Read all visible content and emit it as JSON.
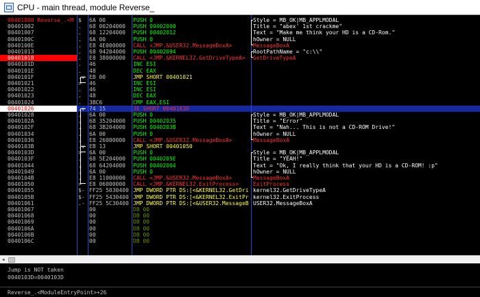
{
  "window": {
    "title": "CPU - main thread, module Reverse_"
  },
  "disasm": {
    "rows": [
      {
        "addr": "00401000 Reverse_.<M",
        "mark": "$",
        "hex": "6A 00",
        "ins": "PUSH 0",
        "cmt": "Style = MB_OK|MB_APPLMODAL",
        "ins_color": "green",
        "cmt_color": "white",
        "addr_entry": true
      },
      {
        "addr": "00401002",
        "mark": ".",
        "hex": "68 00204000",
        "ins": "PUSH 00402000",
        "cmt": "Title = \"abex' 1st crackme\"",
        "ins_color": "green",
        "cmt_color": "white"
      },
      {
        "addr": "00401007",
        "mark": ".",
        "hex": "68 12204000",
        "ins": "PUSH 00402012",
        "cmt": "Text = \"Make me think your HD is a CD-Rom.\"",
        "ins_color": "green",
        "cmt_color": "white"
      },
      {
        "addr": "0040100C",
        "mark": ".",
        "hex": "6A 00",
        "ins": "PUSH 0",
        "cmt": "hOwner = NULL",
        "ins_color": "green",
        "cmt_color": "white"
      },
      {
        "addr": "0040100E",
        "mark": ".",
        "hex": "E8 4E000000",
        "ins": "CALL <JMP.&USER32.MessageBoxA>",
        "cmt": "MessageBoxA",
        "ins_color": "red",
        "cmt_color": "red"
      },
      {
        "addr": "00401013",
        "mark": ".",
        "hex": "68 94204000",
        "ins": "PUSH 00402094",
        "cmt": "RootPathName = \"c:\\\\\"",
        "ins_color": "green",
        "cmt_color": "white"
      },
      {
        "addr": "00401018",
        "mark": ".",
        "hex": "E8 38000000",
        "ins": "CALL <JMP.&KERNEL32.GetDriveTypeA>",
        "cmt": "GetDriveTypeA",
        "ins_color": "red",
        "cmt_color": "red",
        "bp": true
      },
      {
        "addr": "0040101D",
        "mark": ".",
        "hex": "46",
        "ins": "INC ESI",
        "cmt": "",
        "ins_color": "green"
      },
      {
        "addr": "0040101E",
        "mark": ".",
        "hex": "48",
        "ins": "DEC EAX",
        "cmt": "",
        "ins_color": "green"
      },
      {
        "addr": "0040101F",
        "mark": ".v",
        "hex": "EB 00",
        "ins": "JMP SHORT 00401021",
        "cmt": "",
        "ins_color": "yellow"
      },
      {
        "addr": "00401021",
        "mark": ">",
        "hex": "46",
        "ins": "INC ESI",
        "cmt": "",
        "ins_color": "green"
      },
      {
        "addr": "00401022",
        "mark": ".",
        "hex": "46",
        "ins": "INC ESI",
        "cmt": "",
        "ins_color": "green"
      },
      {
        "addr": "00401023",
        "mark": ".",
        "hex": "48",
        "ins": "DEC EAX",
        "cmt": "",
        "ins_color": "green"
      },
      {
        "addr": "00401024",
        "mark": ".",
        "hex": "3BC6",
        "ins": "CMP EAX,ESI",
        "cmt": "",
        "ins_color": "green"
      },
      {
        "addr": "00401026",
        "mark": ".v",
        "hex": "74 15",
        "ins": "JE SHORT 0040103D",
        "cmt": "",
        "ins_color": "red",
        "cur": true
      },
      {
        "addr": "00401028",
        "mark": ".",
        "hex": "6A 00",
        "ins": "PUSH 0",
        "cmt": "Style = MB_OK|MB_APPLMODAL",
        "ins_color": "green",
        "cmt_color": "white"
      },
      {
        "addr": "0040102A",
        "mark": ".",
        "hex": "68 35204000",
        "ins": "PUSH 00402035",
        "cmt": "Title = \"Error\"",
        "ins_color": "green",
        "cmt_color": "white"
      },
      {
        "addr": "0040102F",
        "mark": ".",
        "hex": "68 3B204000",
        "ins": "PUSH 0040203B",
        "cmt": "Text = \"Nah... This is not a CD-ROM Drive!\"",
        "ins_color": "green",
        "cmt_color": "white"
      },
      {
        "addr": "00401034",
        "mark": ".",
        "hex": "6A 00",
        "ins": "PUSH 0",
        "cmt": "hOwner = NULL",
        "ins_color": "green",
        "cmt_color": "white"
      },
      {
        "addr": "00401036",
        "mark": ".",
        "hex": "E8 26000000",
        "ins": "CALL <JMP.&USER32.MessageBoxA>",
        "cmt": "MessageBoxA",
        "ins_color": "red",
        "cmt_color": "red"
      },
      {
        "addr": "0040103B",
        "mark": ".v",
        "hex": "EB 13",
        "ins": "JMP SHORT 00401050",
        "cmt": "",
        "ins_color": "yellow"
      },
      {
        "addr": "0040103D",
        "mark": ">",
        "hex": "6A 00",
        "ins": "PUSH 0",
        "cmt": "Style = MB_OK|MB_APPLMODAL",
        "ins_color": "green",
        "cmt_color": "white"
      },
      {
        "addr": "0040103F",
        "mark": ".",
        "hex": "68 5E204000",
        "ins": "PUSH 0040205E",
        "cmt": "Title = \"YEAH!\"",
        "ins_color": "green",
        "cmt_color": "white"
      },
      {
        "addr": "00401044",
        "mark": ".",
        "hex": "68 64204000",
        "ins": "PUSH 00402064",
        "cmt": "Text = \"Ok, I really think that your HD is a CD-ROM! :p\"",
        "ins_color": "green",
        "cmt_color": "white"
      },
      {
        "addr": "00401049",
        "mark": ".",
        "hex": "6A 00",
        "ins": "PUSH 0",
        "cmt": "hOwner = NULL",
        "ins_color": "green",
        "cmt_color": "white"
      },
      {
        "addr": "0040104B",
        "mark": ".",
        "hex": "E8 11000000",
        "ins": "CALL <JMP.&USER32.MessageBoxA>",
        "cmt": "MessageBoxA",
        "ins_color": "red",
        "cmt_color": "red"
      },
      {
        "addr": "00401050",
        "mark": ">",
        "hex": "E8 06000000",
        "ins": "CALL <JMP.&KERNEL32.ExitProcess>",
        "cmt": "ExitProcess",
        "ins_color": "red",
        "cmt_color": "red"
      },
      {
        "addr": "00401055",
        "mark": "$-",
        "hex": "FF25 5030400",
        "ins": "JMP DWORD PTR DS:[<&KERNEL32.GetDri",
        "cmt": "kernel32.GetDriveTypeA",
        "ins_color": "yellow",
        "cmt_color": "white"
      },
      {
        "addr": "0040105B",
        "mark": "$-",
        "hex": "FF25 5430400",
        "ins": "JMP DWORD PTR DS:[<&KERNEL32.ExitPr",
        "cmt": "kernel32.ExitProcess",
        "ins_color": "yellow",
        "cmt_color": "white"
      },
      {
        "addr": "00401061",
        "mark": ".-",
        "hex": "FF25 5C30400",
        "ins": "JMP DWORD PTR DS:[<&USER32.MessageB",
        "cmt": "USER32.MessageBoxA",
        "ins_color": "yellow",
        "cmt_color": "white"
      },
      {
        "addr": "00401067",
        "mark": "",
        "hex": "00",
        "ins": "DB 00",
        "cmt": "",
        "ins_color": "olive"
      },
      {
        "addr": "00401068",
        "mark": "",
        "hex": "00",
        "ins": "DB 00",
        "cmt": "",
        "ins_color": "olive"
      },
      {
        "addr": "00401069",
        "mark": "",
        "hex": "00",
        "ins": "DB 00",
        "cmt": "",
        "ins_color": "olive"
      },
      {
        "addr": "0040106A",
        "mark": "",
        "hex": "00",
        "ins": "DB 00",
        "cmt": "",
        "ins_color": "olive"
      },
      {
        "addr": "0040106B",
        "mark": "",
        "hex": "00",
        "ins": "DB 00",
        "cmt": "",
        "ins_color": "olive"
      },
      {
        "addr": "0040106C",
        "mark": "",
        "hex": "00",
        "ins": "DB 00",
        "cmt": "",
        "ins_color": "olive"
      }
    ]
  },
  "info": {
    "line1": "Jump is NOT taken",
    "line2": "0040103D=0040103D"
  },
  "status": {
    "text": "Reverse_.<ModuleEntryPoint>+26"
  },
  "colors": {
    "background": "#000000",
    "instruction": "#00ff00",
    "call": "#ff3030",
    "jump": "#ffff40",
    "breakpoint": "#ff0000",
    "separator": "#2a48c8"
  }
}
